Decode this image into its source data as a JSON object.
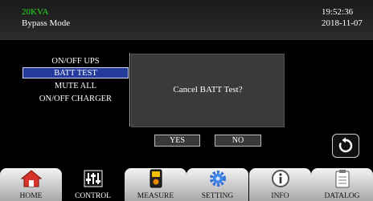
{
  "header": {
    "model": "20KVA",
    "mode": "Bypass Mode",
    "time": "19:52:36",
    "date": "2018-11-07"
  },
  "menu": {
    "items": [
      {
        "label": "ON/OFF  UPS",
        "selected": false
      },
      {
        "label": "BATT TEST",
        "selected": true
      },
      {
        "label": "MUTE ALL",
        "selected": false
      },
      {
        "label": "ON/OFF  CHARGER",
        "selected": false
      }
    ]
  },
  "dialog": {
    "message": "Cancel BATT Test?",
    "yes_label": "YES",
    "no_label": "NO"
  },
  "tabs": [
    {
      "label": "HOME",
      "icon": "home-icon",
      "active": false
    },
    {
      "label": "CONTROL",
      "icon": "sliders-icon",
      "active": true
    },
    {
      "label": "MEASURE",
      "icon": "meter-icon",
      "active": false
    },
    {
      "label": "SETTING",
      "icon": "gear-icon",
      "active": false
    },
    {
      "label": "INFO",
      "icon": "info-icon",
      "active": false
    },
    {
      "label": "DATALOG",
      "icon": "clipboard-icon",
      "active": false
    }
  ],
  "colors": {
    "model_text": "#22dd22",
    "selected_item": "#243b9c"
  }
}
